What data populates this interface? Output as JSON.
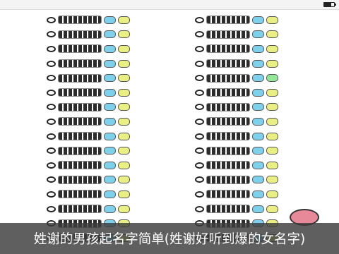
{
  "status_bar": {
    "left_text": "",
    "time": "",
    "battery_text": ""
  },
  "columns": [
    {
      "rows": [
        {
          "name": "",
          "badge1": {
            "text": "",
            "color": "#7fd0ea"
          },
          "badge2": {
            "text": "",
            "color": "#e9ee85"
          }
        },
        {
          "name": "",
          "badge1": {
            "text": "",
            "color": "#7fd0ea"
          },
          "badge2": {
            "text": "",
            "color": "#e9ee85"
          }
        },
        {
          "name": "",
          "badge1": {
            "text": "",
            "color": "#7fd0ea"
          },
          "badge2": {
            "text": "",
            "color": "#e9ee85"
          }
        },
        {
          "name": "",
          "badge1": {
            "text": "",
            "color": "#7fd0ea"
          },
          "badge2": {
            "text": "",
            "color": "#e9ee85"
          }
        },
        {
          "name": "",
          "badge1": {
            "text": "",
            "color": "#7fd0ea"
          },
          "badge2": {
            "text": "",
            "color": "#e9ee85"
          }
        },
        {
          "name": "",
          "badge1": {
            "text": "",
            "color": "#7fd0ea"
          },
          "badge2": {
            "text": "",
            "color": "#e9ee85"
          }
        },
        {
          "name": "",
          "badge1": {
            "text": "",
            "color": "#7fd0ea"
          },
          "badge2": {
            "text": "",
            "color": "#e9ee85"
          }
        },
        {
          "name": "",
          "badge1": {
            "text": "",
            "color": "#7fd0ea"
          },
          "badge2": {
            "text": "",
            "color": "#e9ee85"
          }
        },
        {
          "name": "",
          "badge1": {
            "text": "",
            "color": "#7fd0ea"
          },
          "badge2": {
            "text": "",
            "color": "#e9ee85"
          }
        },
        {
          "name": "",
          "badge1": {
            "text": "",
            "color": "#7fd0ea"
          },
          "badge2": {
            "text": "",
            "color": "#e9ee85"
          }
        },
        {
          "name": "",
          "badge1": {
            "text": "",
            "color": "#7fd0ea"
          },
          "badge2": {
            "text": "",
            "color": "#e9ee85"
          }
        },
        {
          "name": "",
          "badge1": {
            "text": "",
            "color": "#7fd0ea"
          },
          "badge2": {
            "text": "",
            "color": "#e9ee85"
          }
        },
        {
          "name": "",
          "badge1": {
            "text": "",
            "color": "#7fd0ea"
          },
          "badge2": {
            "text": "",
            "color": "#e9ee85"
          }
        },
        {
          "name": "",
          "badge1": {
            "text": "",
            "color": "#7fd0ea"
          },
          "badge2": {
            "text": "",
            "color": "#e9ee85"
          }
        },
        {
          "name": "",
          "badge1": {
            "text": "",
            "color": "#7fd0ea"
          },
          "badge2": {
            "text": "",
            "color": "#e9ee85"
          }
        },
        {
          "name": "",
          "badge1": {
            "text": "",
            "color": "#7fd0ea"
          },
          "badge2": {
            "text": "",
            "color": "#e9ee85"
          }
        }
      ]
    },
    {
      "rows": [
        {
          "name": "",
          "badge1": {
            "text": "",
            "color": "#7fd0ea"
          },
          "badge2": {
            "text": "",
            "color": "#e9ee85"
          }
        },
        {
          "name": "",
          "badge1": {
            "text": "",
            "color": "#7fd0ea"
          },
          "badge2": {
            "text": "",
            "color": "#e9ee85"
          }
        },
        {
          "name": "",
          "badge1": {
            "text": "",
            "color": "#7fd0ea"
          },
          "badge2": {
            "text": "",
            "color": "#e9ee85"
          }
        },
        {
          "name": "",
          "badge1": {
            "text": "",
            "color": "#7fd0ea"
          },
          "badge2": {
            "text": "",
            "color": "#e9ee85"
          }
        },
        {
          "name": "",
          "badge1": {
            "text": "",
            "color": "#7fd0ea"
          },
          "badge2": {
            "text": "",
            "color": "#95e59a"
          }
        },
        {
          "name": "",
          "badge1": {
            "text": "",
            "color": "#7fd0ea"
          },
          "badge2": {
            "text": "",
            "color": "#e9ee85"
          }
        },
        {
          "name": "",
          "badge1": {
            "text": "",
            "color": "#7fd0ea"
          },
          "badge2": {
            "text": "",
            "color": "#e9ee85"
          }
        },
        {
          "name": "",
          "badge1": {
            "text": "",
            "color": "#7fd0ea"
          },
          "badge2": {
            "text": "",
            "color": "#e9ee85"
          }
        },
        {
          "name": "",
          "badge1": {
            "text": "",
            "color": "#7fd0ea"
          },
          "badge2": {
            "text": "",
            "color": "#e9ee85"
          }
        },
        {
          "name": "",
          "badge1": {
            "text": "",
            "color": "#7fd0ea"
          },
          "badge2": {
            "text": "",
            "color": "#e9ee85"
          }
        },
        {
          "name": "",
          "badge1": {
            "text": "",
            "color": "#7fd0ea"
          },
          "badge2": {
            "text": "",
            "color": "#e9ee85"
          }
        },
        {
          "name": "",
          "badge1": {
            "text": "",
            "color": "#7fd0ea"
          },
          "badge2": {
            "text": "",
            "color": "#e9ee85"
          }
        },
        {
          "name": "",
          "badge1": {
            "text": "",
            "color": "#7fd0ea"
          },
          "badge2": {
            "text": "",
            "color": "#e9ee85"
          }
        },
        {
          "name": "",
          "badge1": {
            "text": "",
            "color": "#7fd0ea"
          },
          "badge2": {
            "text": "",
            "color": "#e9ee85"
          }
        },
        {
          "name": "",
          "badge1": {
            "text": "",
            "color": "#7fd0ea"
          },
          "badge2": {
            "text": "",
            "color": "#e9ee85"
          }
        },
        {
          "name": "",
          "badge1": {
            "text": "",
            "color": "#7fd0ea"
          },
          "badge2": {
            "text": "",
            "color": "#e9ee85"
          }
        }
      ]
    }
  ],
  "fab": {
    "label": "",
    "color": "#e8899a"
  },
  "caption": "姓谢的男孩起名字简单(姓谢好听到爆的女名字)"
}
